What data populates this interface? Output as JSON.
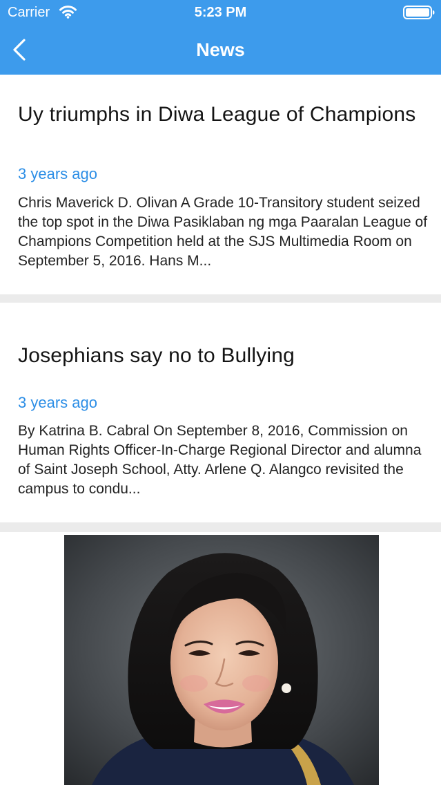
{
  "status_bar": {
    "carrier": "Carrier",
    "time": "5:23 PM"
  },
  "nav": {
    "title": "News",
    "back_icon": "chevron-left-icon"
  },
  "news": [
    {
      "title": "Uy triumphs in Diwa League of Champions",
      "time_ago": "3 years ago",
      "summary": "Chris Maverick D. Olivan A Grade 10-Transitory student seized the top spot in the Diwa Pasiklaban ng mga Paaralan League of Champions Competition held at the SJS Multimedia Room on September 5, 2016. Hans M..."
    },
    {
      "title": "Josephians say no to Bullying",
      "time_ago": "3 years ago",
      "summary": "By Katrina B. Cabral On September 8, 2016, Commission on Human Rights Officer-In-Charge Regional Director and alumna of Saint Joseph School, Atty. Arlene Q. Alangco revisited the campus to condu..."
    }
  ],
  "colors": {
    "accent": "#3d9bec",
    "timestamp": "#2c8ee6",
    "divider": "#ebebeb"
  }
}
